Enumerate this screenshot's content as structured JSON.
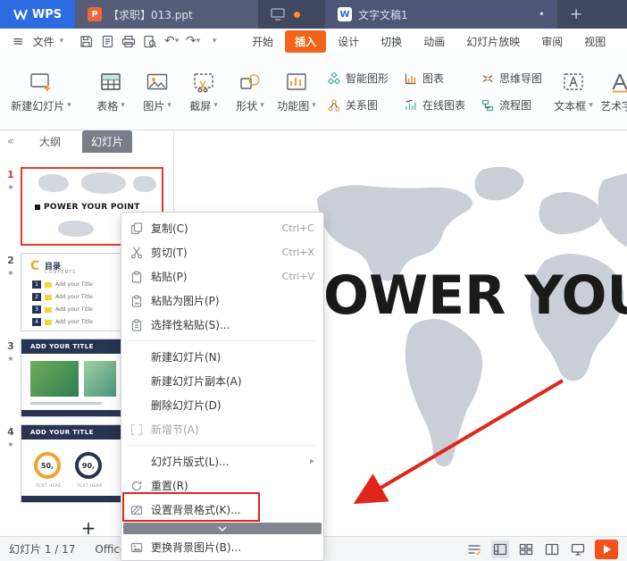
{
  "glyphs": {
    "caret": "▾",
    "star": "★",
    "collapse": "«",
    "submenu": "▸",
    "hamburger": "≡",
    "undo": "↶",
    "redo": "↷",
    "dot": "•"
  },
  "titlebar": {
    "logo": "WPS",
    "tab_ppt": "【求职】013.ppt",
    "tab_doc": "文字文稿1",
    "new_tab": "+"
  },
  "menubar": {
    "file": "文件",
    "tabs": [
      "开始",
      "插入",
      "设计",
      "切换",
      "动画",
      "幻灯片放映",
      "审阅",
      "视图"
    ],
    "active": "插入"
  },
  "ribbon": {
    "new_slide": "新建幻灯片",
    "table": "表格",
    "picture": "图片",
    "screenshot": "截屏",
    "shapes": "形状",
    "func": "功能图",
    "smartart": "智能图形",
    "relation": "关系图",
    "chart": "图表",
    "online_chart": "在线图表",
    "mindmap": "思维导图",
    "flowchart": "流程图",
    "textbox": "文本框",
    "wordart": "艺术字"
  },
  "sidebar": {
    "tab_outline": "大纲",
    "tab_slides": "幻灯片",
    "add_slide": "+",
    "slides": [
      {
        "num": "1",
        "title": "POWER YOUR POINT"
      },
      {
        "num": "2",
        "c": "C",
        "heading": "目录",
        "sub": "CONTENTS",
        "n1": "1",
        "n2": "2",
        "n3": "3",
        "n4": "4",
        "row": "Add your Title"
      },
      {
        "num": "3",
        "title": "ADD YOUR TITLE"
      },
      {
        "num": "4",
        "title": "ADD YOUR TITLE",
        "v1": "50,",
        "v2": "90,",
        "cap": "TEXT HERE"
      }
    ]
  },
  "context_menu": {
    "items": [
      {
        "label": "复制(C)",
        "shortcut": "Ctrl+C"
      },
      {
        "label": "剪切(T)",
        "shortcut": "Ctrl+X"
      },
      {
        "label": "粘贴(P)",
        "shortcut": "Ctrl+V"
      },
      {
        "label": "粘贴为图片(P)",
        "shortcut": ""
      },
      {
        "label": "选择性粘贴(S)...",
        "shortcut": ""
      },
      {
        "label": "新建幻灯片(N)",
        "shortcut": ""
      },
      {
        "label": "新建幻灯片副本(A)",
        "shortcut": ""
      },
      {
        "label": "删除幻灯片(D)",
        "shortcut": ""
      },
      {
        "label": "新增节(A)",
        "shortcut": ""
      },
      {
        "label": "幻灯片版式(L)...",
        "shortcut": ""
      },
      {
        "label": "重置(R)",
        "shortcut": ""
      },
      {
        "label": "设置背景格式(K)...",
        "shortcut": ""
      },
      {
        "label": "更换背景图片(B)...",
        "shortcut": ""
      }
    ]
  },
  "canvas": {
    "title": "POWER YOUR POINT"
  },
  "statusbar": {
    "slides": "幻灯片 1 / 17",
    "theme": "Office 主题"
  }
}
